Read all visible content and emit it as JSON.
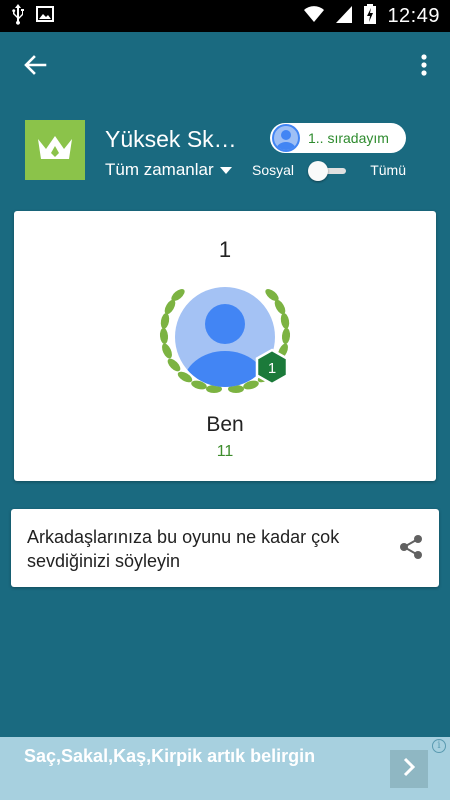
{
  "status_bar": {
    "time": "12:49",
    "icons": [
      "usb-icon",
      "image-icon",
      "wifi-icon",
      "signal-icon",
      "battery-charging-icon"
    ]
  },
  "app_bar": {
    "back_icon": "arrow-back-icon",
    "menu_icon": "more-vert-icon"
  },
  "leaderboard": {
    "title": "Yüksek Sk…",
    "icon": "crown-icon",
    "icon_bg": "#8bc34a",
    "timespan": "Tüm zamanlar",
    "rank_chip": "1.. sıradayım",
    "toggle_left": "Sosyal",
    "toggle_right": "Tümü"
  },
  "player": {
    "rank": "1",
    "level": "1",
    "name": "Ben",
    "score": "11"
  },
  "share_card": {
    "text": "Arkadaşlarınıza bu oyunu ne kadar çok sevdiğinizi söyleyin"
  },
  "ad": {
    "text": "Saç,Sakal,Kaş,Kirpik artık belirgin",
    "info": "i"
  },
  "colors": {
    "background": "#1a6a80",
    "accent_green": "#3d8c2c",
    "avatar_blue": "#4285f4",
    "level_badge": "#1b7a3a"
  }
}
